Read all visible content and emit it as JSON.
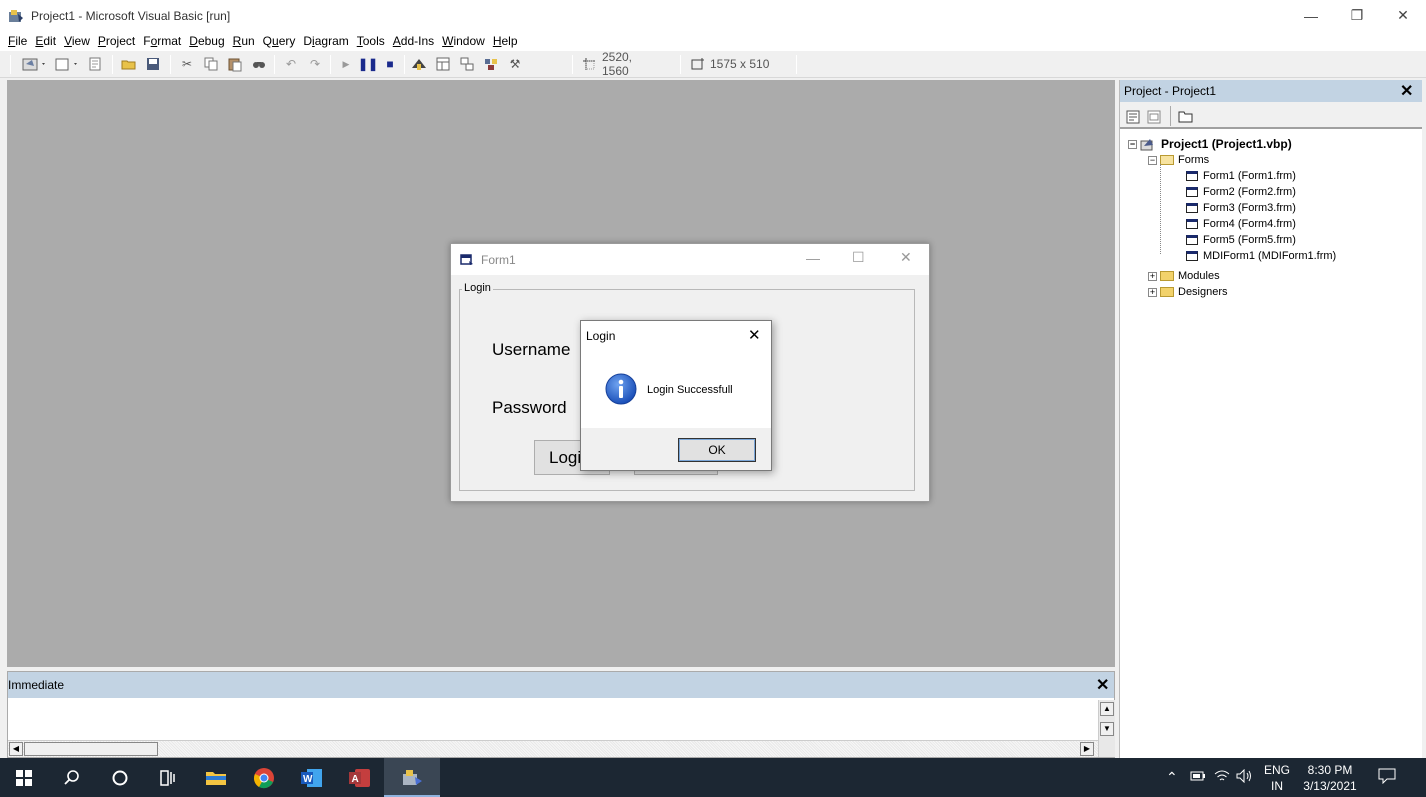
{
  "window": {
    "title": "Project1 - Microsoft Visual Basic [run]"
  },
  "menu": [
    {
      "pre": "",
      "u": "F",
      "post": "ile"
    },
    {
      "pre": "",
      "u": "E",
      "post": "dit"
    },
    {
      "pre": "",
      "u": "V",
      "post": "iew"
    },
    {
      "pre": "",
      "u": "P",
      "post": "roject"
    },
    {
      "pre": "F",
      "u": "o",
      "post": "rmat"
    },
    {
      "pre": "",
      "u": "D",
      "post": "ebug"
    },
    {
      "pre": "",
      "u": "R",
      "post": "un"
    },
    {
      "pre": "Q",
      "u": "u",
      "post": "ery"
    },
    {
      "pre": "D",
      "u": "i",
      "post": "agram"
    },
    {
      "pre": "",
      "u": "T",
      "post": "ools"
    },
    {
      "pre": "",
      "u": "A",
      "post": "dd-Ins"
    },
    {
      "pre": "",
      "u": "W",
      "post": "indow"
    },
    {
      "pre": "",
      "u": "H",
      "post": "elp"
    }
  ],
  "toolbar": {
    "position": "2520, 1560",
    "size": "1575 x 510"
  },
  "form1": {
    "title": "Form1",
    "frame_label": "Login",
    "username_label": "Username",
    "password_label": "Password",
    "login_button": "Logi"
  },
  "msgbox": {
    "title": "Login",
    "message": "Login Successfull",
    "ok": "OK"
  },
  "project": {
    "title": "Project - Project1",
    "root": "Project1 (Project1.vbp)",
    "forms_folder": "Forms",
    "forms": [
      "Form1 (Form1.frm)",
      "Form2 (Form2.frm)",
      "Form3 (Form3.frm)",
      "Form4 (Form4.frm)",
      "Form5 (Form5.frm)",
      "MDIForm1 (MDIForm1.frm)"
    ],
    "modules": "Modules",
    "designers": "Designers"
  },
  "immediate": {
    "title": "Immediate"
  },
  "tray": {
    "lang1": "ENG",
    "lang2": "IN",
    "time": "8:30 PM",
    "date": "3/13/2021"
  }
}
